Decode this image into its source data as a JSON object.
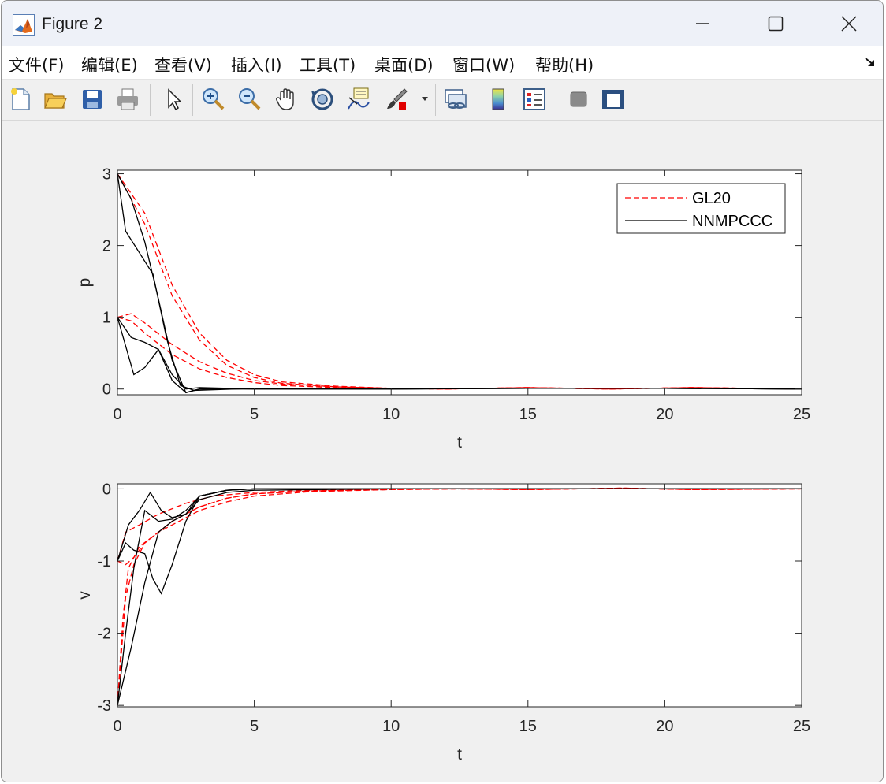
{
  "window": {
    "title": "Figure 2",
    "icon": "matlab-icon",
    "controls": [
      "minimize-icon",
      "maximize-icon",
      "close-icon"
    ]
  },
  "menu": {
    "items": [
      {
        "label": "文件(F)",
        "key": "F"
      },
      {
        "label": "编辑(E)",
        "key": "E"
      },
      {
        "label": "查看(V)",
        "key": "V"
      },
      {
        "label": "插入(I)",
        "key": "I"
      },
      {
        "label": "工具(T)",
        "key": "T"
      },
      {
        "label": "桌面(D)",
        "key": "D"
      },
      {
        "label": "窗口(W)",
        "key": "W"
      },
      {
        "label": "帮助(H)",
        "key": "H"
      }
    ],
    "dock_icon": "dock-arrow-icon"
  },
  "toolbar": {
    "icons": [
      "new-figure-icon",
      "open-file-icon",
      "save-icon",
      "print-icon",
      "edit-plot-arrow-icon",
      "zoom-in-icon",
      "zoom-out-icon",
      "pan-hand-icon",
      "rotate-3d-icon",
      "data-cursor-icon",
      "brush-icon",
      "brush-dropdown-icon",
      "link-plot-icon",
      "colorbar-icon",
      "legend-icon",
      "hide-plot-tools-icon",
      "show-plot-tools-icon"
    ]
  },
  "chart_data": [
    {
      "type": "line",
      "xlabel": "t",
      "ylabel": "p",
      "xlim": [
        0,
        25
      ],
      "ylim": [
        -0.08,
        3.05
      ],
      "xticks": [
        "0",
        "5",
        "10",
        "15",
        "20",
        "25"
      ],
      "yticks": [
        "0",
        "1",
        "2",
        "3"
      ],
      "legend_position": "top-right",
      "legend": [
        {
          "label": "GL20",
          "style": "dashed",
          "color": "#ff0000"
        },
        {
          "label": "NNMPCCC",
          "style": "solid",
          "color": "#000000"
        }
      ],
      "series": [
        {
          "group": "GL20",
          "style": "dashed",
          "color": "#ff0000",
          "points": [
            [
              0,
              3.0
            ],
            [
              1,
              2.45
            ],
            [
              2,
              1.45
            ],
            [
              3,
              0.78
            ],
            [
              4,
              0.4
            ],
            [
              5,
              0.2
            ],
            [
              6,
              0.1
            ],
            [
              8,
              0.04
            ],
            [
              10,
              0.01
            ],
            [
              12,
              0.0
            ],
            [
              15,
              0.02
            ],
            [
              18,
              0.0
            ],
            [
              21,
              0.02
            ],
            [
              25,
              0.0
            ]
          ]
        },
        {
          "group": "GL20",
          "style": "dashed",
          "color": "#ff0000",
          "points": [
            [
              0,
              3.0
            ],
            [
              1,
              2.3
            ],
            [
              2,
              1.3
            ],
            [
              3,
              0.68
            ],
            [
              4,
              0.33
            ],
            [
              5,
              0.16
            ],
            [
              6,
              0.08
            ],
            [
              8,
              0.03
            ],
            [
              10,
              0.01
            ],
            [
              12,
              0.0
            ],
            [
              15,
              0.02
            ],
            [
              18,
              0.0
            ],
            [
              21,
              0.02
            ],
            [
              25,
              0.0
            ]
          ]
        },
        {
          "group": "GL20",
          "style": "dashed",
          "color": "#ff0000",
          "points": [
            [
              0,
              1.0
            ],
            [
              0.5,
              1.05
            ],
            [
              1,
              0.92
            ],
            [
              2,
              0.62
            ],
            [
              3,
              0.38
            ],
            [
              4,
              0.22
            ],
            [
              5,
              0.12
            ],
            [
              6,
              0.07
            ],
            [
              8,
              0.03
            ],
            [
              10,
              0.01
            ],
            [
              12,
              0.0
            ],
            [
              15,
              0.02
            ],
            [
              18,
              0.0
            ],
            [
              21,
              0.02
            ],
            [
              25,
              0.0
            ]
          ]
        },
        {
          "group": "GL20",
          "style": "dashed",
          "color": "#ff0000",
          "points": [
            [
              0,
              1.0
            ],
            [
              0.5,
              0.95
            ],
            [
              1,
              0.78
            ],
            [
              2,
              0.48
            ],
            [
              3,
              0.28
            ],
            [
              4,
              0.16
            ],
            [
              5,
              0.09
            ],
            [
              6,
              0.05
            ],
            [
              8,
              0.02
            ],
            [
              10,
              0.01
            ],
            [
              12,
              0.0
            ],
            [
              15,
              0.02
            ],
            [
              18,
              0.0
            ],
            [
              21,
              0.02
            ],
            [
              25,
              0.0
            ]
          ]
        },
        {
          "group": "NNMPCCC",
          "style": "solid",
          "color": "#000000",
          "points": [
            [
              0,
              3.0
            ],
            [
              0.5,
              2.65
            ],
            [
              1,
              2.05
            ],
            [
              1.5,
              1.25
            ],
            [
              2,
              0.4
            ],
            [
              2.5,
              -0.05
            ],
            [
              3,
              0.0
            ],
            [
              5,
              0.01
            ],
            [
              10,
              0.0
            ],
            [
              15,
              0.01
            ],
            [
              20,
              0.01
            ],
            [
              25,
              0.0
            ]
          ]
        },
        {
          "group": "NNMPCCC",
          "style": "solid",
          "color": "#000000",
          "points": [
            [
              0,
              3.0
            ],
            [
              0.3,
              2.2
            ],
            [
              0.8,
              1.9
            ],
            [
              1.3,
              1.6
            ],
            [
              1.8,
              0.7
            ],
            [
              2.3,
              0.05
            ],
            [
              2.8,
              -0.02
            ],
            [
              5,
              0.01
            ],
            [
              10,
              0.0
            ],
            [
              15,
              0.01
            ],
            [
              20,
              0.01
            ],
            [
              25,
              0.0
            ]
          ]
        },
        {
          "group": "NNMPCCC",
          "style": "solid",
          "color": "#000000",
          "points": [
            [
              0,
              1.0
            ],
            [
              0.3,
              0.6
            ],
            [
              0.6,
              0.2
            ],
            [
              1,
              0.3
            ],
            [
              1.5,
              0.55
            ],
            [
              2,
              0.2
            ],
            [
              2.5,
              0.0
            ],
            [
              3,
              0.02
            ],
            [
              5,
              0.0
            ],
            [
              10,
              0.0
            ],
            [
              15,
              0.01
            ],
            [
              20,
              0.01
            ],
            [
              25,
              0.0
            ]
          ]
        },
        {
          "group": "NNMPCCC",
          "style": "solid",
          "color": "#000000",
          "points": [
            [
              0,
              1.0
            ],
            [
              0.5,
              0.72
            ],
            [
              1,
              0.65
            ],
            [
              1.5,
              0.55
            ],
            [
              2,
              0.12
            ],
            [
              2.5,
              -0.05
            ],
            [
              3,
              0.0
            ],
            [
              5,
              0.0
            ],
            [
              10,
              0.0
            ],
            [
              15,
              0.01
            ],
            [
              20,
              0.01
            ],
            [
              25,
              0.0
            ]
          ]
        }
      ]
    },
    {
      "type": "line",
      "xlabel": "t",
      "ylabel": "v",
      "xlim": [
        0,
        25
      ],
      "ylim": [
        -3.02,
        0.07
      ],
      "xticks": [
        "0",
        "5",
        "10",
        "15",
        "20",
        "25"
      ],
      "yticks": [
        "-3",
        "-2",
        "-1",
        "0"
      ],
      "series": [
        {
          "group": "GL20",
          "style": "dashed",
          "color": "#ff0000",
          "points": [
            [
              0,
              -3.0
            ],
            [
              0.2,
              -1.8
            ],
            [
              0.4,
              -1.1
            ],
            [
              0.8,
              -0.8
            ],
            [
              1.5,
              -0.6
            ],
            [
              2,
              -0.5
            ],
            [
              3,
              -0.3
            ],
            [
              4,
              -0.18
            ],
            [
              5,
              -0.1
            ],
            [
              7,
              -0.04
            ],
            [
              10,
              -0.01
            ],
            [
              12.5,
              0.0
            ],
            [
              15,
              -0.01
            ],
            [
              18.5,
              0.01
            ],
            [
              21,
              -0.01
            ],
            [
              25,
              0.0
            ]
          ]
        },
        {
          "group": "GL20",
          "style": "dashed",
          "color": "#ff0000",
          "points": [
            [
              0,
              -3.0
            ],
            [
              0.3,
              -1.5
            ],
            [
              0.6,
              -1.05
            ],
            [
              1,
              -0.75
            ],
            [
              2,
              -0.45
            ],
            [
              3,
              -0.25
            ],
            [
              4,
              -0.13
            ],
            [
              5,
              -0.07
            ],
            [
              7,
              -0.03
            ],
            [
              10,
              -0.01
            ],
            [
              12.5,
              0.0
            ],
            [
              15,
              -0.01
            ],
            [
              18.5,
              0.01
            ],
            [
              21,
              -0.01
            ],
            [
              25,
              0.0
            ]
          ]
        },
        {
          "group": "GL20",
          "style": "dashed",
          "color": "#ff0000",
          "points": [
            [
              0,
              -1.0
            ],
            [
              0.3,
              -1.05
            ],
            [
              0.6,
              -0.95
            ],
            [
              1,
              -0.75
            ],
            [
              2,
              -0.45
            ],
            [
              3,
              -0.25
            ],
            [
              4,
              -0.13
            ],
            [
              5,
              -0.07
            ],
            [
              7,
              -0.03
            ],
            [
              10,
              -0.01
            ],
            [
              12.5,
              0.0
            ],
            [
              15,
              -0.01
            ],
            [
              18.5,
              0.01
            ],
            [
              21,
              -0.01
            ],
            [
              25,
              0.0
            ]
          ]
        },
        {
          "group": "GL20",
          "style": "dashed",
          "color": "#ff0000",
          "points": [
            [
              0,
              -1.0
            ],
            [
              0.3,
              -0.6
            ],
            [
              0.8,
              -0.5
            ],
            [
              1.5,
              -0.35
            ],
            [
              2.5,
              -0.2
            ],
            [
              3.5,
              -0.1
            ],
            [
              5,
              -0.05
            ],
            [
              7,
              -0.02
            ],
            [
              10,
              0.0
            ],
            [
              12.5,
              0.0
            ],
            [
              15,
              -0.01
            ],
            [
              18.5,
              0.01
            ],
            [
              21,
              -0.01
            ],
            [
              25,
              0.0
            ]
          ]
        },
        {
          "group": "NNMPCCC",
          "style": "solid",
          "color": "#000000",
          "points": [
            [
              0,
              -3.0
            ],
            [
              0.5,
              -2.2
            ],
            [
              1,
              -1.3
            ],
            [
              1.5,
              -0.6
            ],
            [
              2,
              -0.45
            ],
            [
              2.5,
              -0.35
            ],
            [
              3,
              -0.15
            ],
            [
              4,
              -0.05
            ],
            [
              5,
              -0.02
            ],
            [
              10,
              0.0
            ],
            [
              15,
              0.0
            ],
            [
              20,
              0.0
            ],
            [
              25,
              0.0
            ]
          ]
        },
        {
          "group": "NNMPCCC",
          "style": "solid",
          "color": "#000000",
          "points": [
            [
              0,
              -3.0
            ],
            [
              0.3,
              -2.0
            ],
            [
              0.6,
              -1.1
            ],
            [
              1,
              -0.3
            ],
            [
              1.5,
              -0.45
            ],
            [
              2,
              -0.42
            ],
            [
              2.5,
              -0.3
            ],
            [
              3,
              -0.1
            ],
            [
              4,
              -0.02
            ],
            [
              5,
              0.0
            ],
            [
              10,
              0.0
            ],
            [
              15,
              0.0
            ],
            [
              20,
              0.0
            ],
            [
              25,
              0.0
            ]
          ]
        },
        {
          "group": "NNMPCCC",
          "style": "solid",
          "color": "#000000",
          "points": [
            [
              0,
              -1.0
            ],
            [
              0.3,
              -0.75
            ],
            [
              0.6,
              -0.85
            ],
            [
              1,
              -0.9
            ],
            [
              1.3,
              -1.25
            ],
            [
              1.6,
              -1.45
            ],
            [
              2,
              -1.05
            ],
            [
              2.5,
              -0.45
            ],
            [
              3,
              -0.1
            ],
            [
              4,
              -0.02
            ],
            [
              5,
              0.0
            ],
            [
              10,
              0.0
            ],
            [
              15,
              0.0
            ],
            [
              20,
              0.0
            ],
            [
              25,
              0.0
            ]
          ]
        },
        {
          "group": "NNMPCCC",
          "style": "solid",
          "color": "#000000",
          "points": [
            [
              0,
              -1.0
            ],
            [
              0.4,
              -0.5
            ],
            [
              0.8,
              -0.3
            ],
            [
              1.2,
              -0.05
            ],
            [
              1.6,
              -0.3
            ],
            [
              2,
              -0.4
            ],
            [
              2.5,
              -0.35
            ],
            [
              3,
              -0.1
            ],
            [
              4,
              -0.02
            ],
            [
              5,
              0.0
            ],
            [
              10,
              0.0
            ],
            [
              15,
              0.0
            ],
            [
              20,
              0.0
            ],
            [
              25,
              0.0
            ]
          ]
        }
      ]
    }
  ]
}
